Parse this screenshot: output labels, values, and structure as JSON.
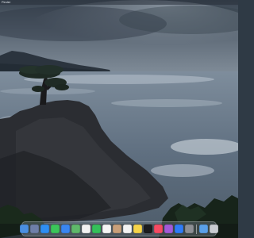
{
  "menubar": {
    "items": [
      "Finder"
    ]
  },
  "colors": {
    "sky_top": "#3e4a57",
    "sky_mid": "#6a7684",
    "sea": "#7f8fa0",
    "rock": "#2a2c31",
    "dock_bg": "#7a838c"
  },
  "dock": {
    "apps": [
      {
        "name": "finder-icon",
        "color": "#4a8fe0"
      },
      {
        "name": "launchpad-icon",
        "color": "#6e7fa8"
      },
      {
        "name": "safari-icon",
        "color": "#2f8ef2"
      },
      {
        "name": "messages-icon",
        "color": "#3cc55a"
      },
      {
        "name": "mail-icon",
        "color": "#3a86f0"
      },
      {
        "name": "maps-icon",
        "color": "#5fb86a"
      },
      {
        "name": "photos-icon",
        "color": "#f2f2f2"
      },
      {
        "name": "facetime-icon",
        "color": "#35c05a"
      },
      {
        "name": "calendar-icon",
        "color": "#f5f5f5"
      },
      {
        "name": "contacts-icon",
        "color": "#c9a07a"
      },
      {
        "name": "reminders-icon",
        "color": "#f3f3f3"
      },
      {
        "name": "notes-icon",
        "color": "#f6d44a"
      },
      {
        "name": "tv-icon",
        "color": "#1c1c1e"
      },
      {
        "name": "music-icon",
        "color": "#f54b63"
      },
      {
        "name": "podcasts-icon",
        "color": "#a35ad8"
      },
      {
        "name": "app-store-icon",
        "color": "#2f7cf6"
      },
      {
        "name": "system-settings-icon",
        "color": "#8d8f94"
      }
    ],
    "extras": [
      {
        "name": "downloads-folder-icon",
        "color": "#5aa0e8"
      },
      {
        "name": "trash-icon",
        "color": "#c9ccd1"
      }
    ]
  }
}
